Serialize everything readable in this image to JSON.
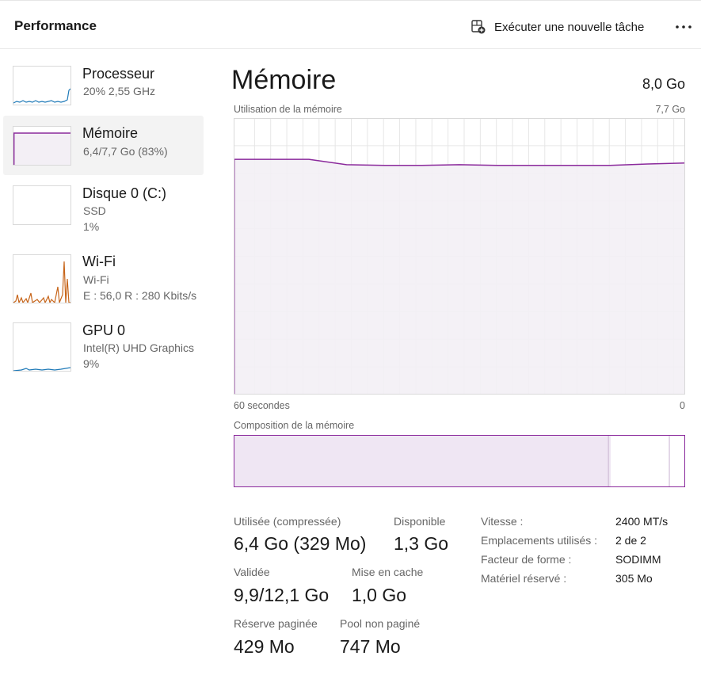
{
  "header": {
    "title": "Performance",
    "run_task_label": "Exécuter une nouvelle tâche",
    "run_task_icon": "new-task-icon",
    "more_icon": "more-horizontal-icon"
  },
  "sidebar": {
    "items": [
      {
        "name": "Processeur",
        "line1": "20%  2,55 GHz",
        "line2": "",
        "color": "#1f7ab8",
        "usage": 0.2
      },
      {
        "name": "Mémoire",
        "line1": "6,4/7,7 Go (83%)",
        "line2": "",
        "color": "#8b2a9c",
        "usage": 0.83
      },
      {
        "name": "Disque 0 (C:)",
        "line1": "SSD",
        "line2": "1%",
        "color": "#4aa336",
        "usage": 0.01
      },
      {
        "name": "Wi-Fi",
        "line1": "Wi-Fi",
        "line2": "E : 56,0  R : 280 Kbits/s",
        "color": "#c7651a",
        "usage": null
      },
      {
        "name": "GPU 0",
        "line1": "Intel(R) UHD Graphics",
        "line2": "9%",
        "color": "#1f7ab8",
        "usage": 0.09
      }
    ]
  },
  "main": {
    "title": "Mémoire",
    "total": "8,0 Go",
    "usage_chart": {
      "label": "Utilisation de la mémoire",
      "max_label": "7,7 Go",
      "x_left_label": "60 secondes",
      "x_right_label": "0",
      "line_color": "#8b2a9c",
      "fill_color": "#f3eff5",
      "grid_color": "#e6e6e6"
    },
    "composition": {
      "label": "Composition de la mémoire",
      "in_use_fraction": 0.83,
      "modified_fraction": 0.005,
      "standby_fraction": 0.13,
      "border_color": "#8b2a9c",
      "fill_color": "#efe6f3"
    },
    "stats": {
      "used_label": "Utilisée (compressée)",
      "used_value": "6,4 Go (329 Mo)",
      "available_label": "Disponible",
      "available_value": "1,3 Go",
      "committed_label": "Validée",
      "committed_value": "9,9/12,1 Go",
      "cached_label": "Mise en cache",
      "cached_value": "1,0 Go",
      "paged_label": "Réserve paginée",
      "paged_value": "429 Mo",
      "nonpaged_label": "Pool non paginé",
      "nonpaged_value": "747 Mo"
    },
    "info": [
      {
        "label": "Vitesse :",
        "value": "2400 MT/s"
      },
      {
        "label": "Emplacements utilisés :",
        "value": "2 de 2"
      },
      {
        "label": "Facteur de forme :",
        "value": "SODIMM"
      },
      {
        "label": "Matériel réservé :",
        "value": "305 Mo"
      }
    ]
  },
  "chart_data": {
    "type": "area",
    "x": [
      60,
      55,
      50,
      45,
      40,
      35,
      30,
      25,
      20,
      15,
      10,
      5,
      0
    ],
    "series": [
      {
        "values": [
          6.55,
          6.55,
          6.55,
          6.4,
          6.38,
          6.38,
          6.4,
          6.38,
          6.38,
          6.38,
          6.38,
          6.42,
          6.45
        ]
      }
    ],
    "title": "",
    "xlabel": "",
    "ylabel": "",
    "ylim": [
      0,
      7.7
    ],
    "xlim": [
      60,
      0
    ],
    "grid": true
  }
}
